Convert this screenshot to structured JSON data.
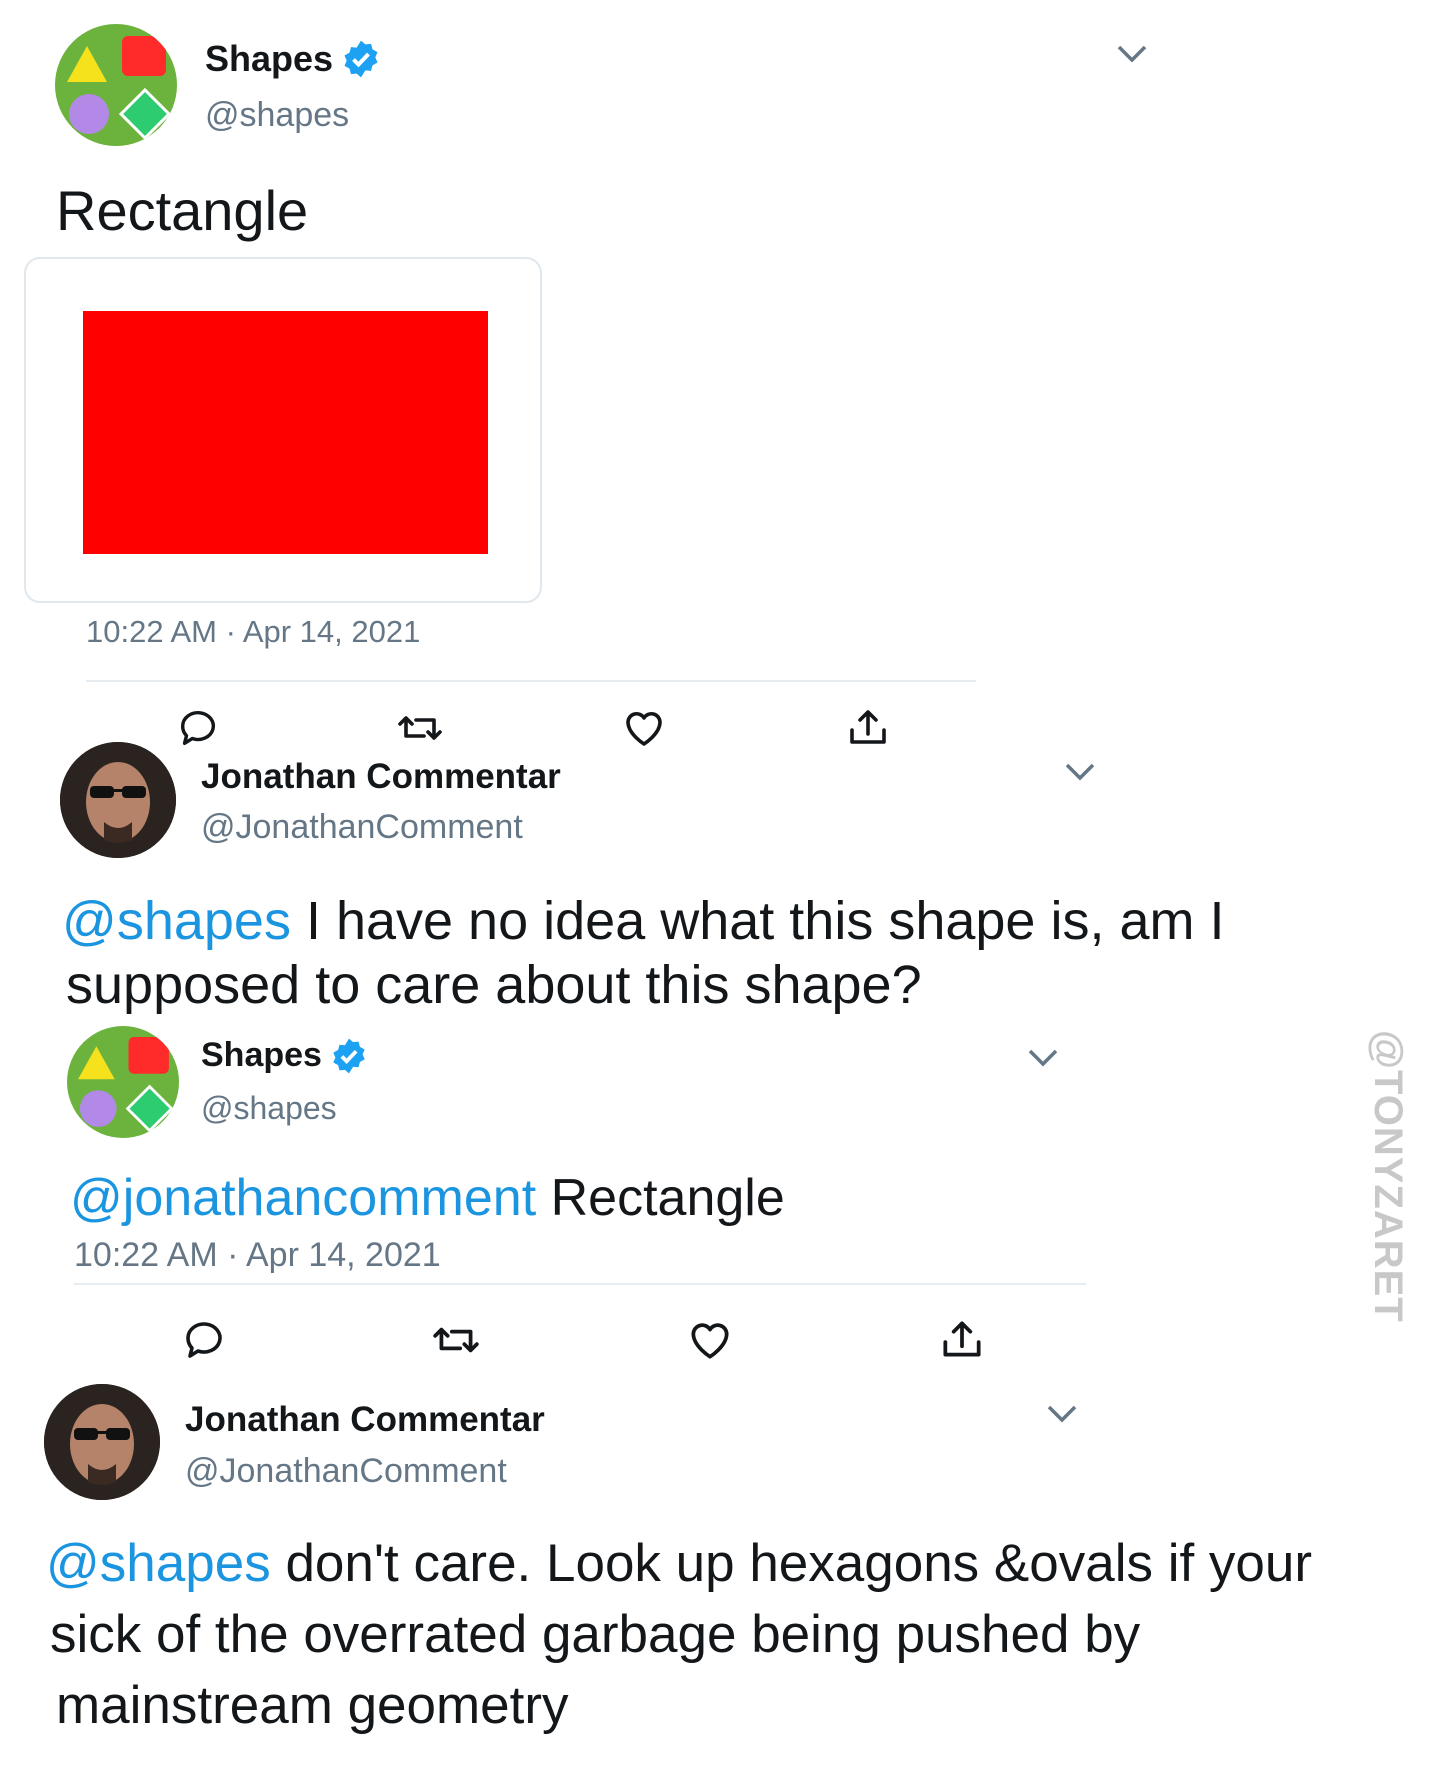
{
  "tweet1": {
    "name": "Shapes",
    "handle": "@shapes",
    "text": "Rectangle",
    "media_color": "#ff0000",
    "timestamp": "10:22 AM · Apr 14, 2021"
  },
  "reply1": {
    "name": "Jonathan Commentar",
    "handle": "@JonathanComment",
    "mention": "@shapes",
    "line1": " I have no idea what this shape is, am I",
    "line2": "supposed to care about this shape?"
  },
  "reply2": {
    "name": "Shapes",
    "handle": "@shapes",
    "mention": "@jonathancomment",
    "text": " Rectangle",
    "timestamp": "10:22 AM · Apr 14, 2021"
  },
  "reply3": {
    "name": "Jonathan Commentar",
    "handle": "@JonathanComment",
    "mention": "@shapes",
    "line1": " don't care. Look up hexagons &ovals if your",
    "line2": "sick of the overrated  garbage being pushed by",
    "line3": "mainstream geometry"
  },
  "watermark": "@TONYZARET",
  "colors": {
    "mention": "#1b95e0",
    "verified": "#1da1f2",
    "muted": "#657786"
  }
}
